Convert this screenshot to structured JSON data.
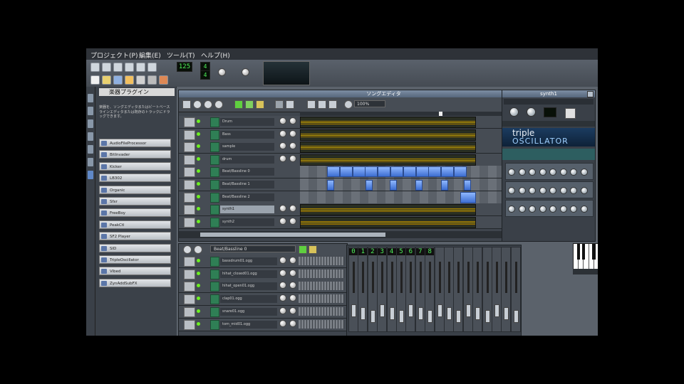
{
  "menu": [
    "プロジェクト(P)",
    "編集(E)",
    "ツール(T)",
    "ヘルプ(H)"
  ],
  "toolbar": {
    "tempo": "125",
    "time_sig_top": "4",
    "time_sig_bottom": "4"
  },
  "sidebar": {
    "title": "楽器プラグイン",
    "description": "楽器を、ソングエディタまたはビートベースラインエディタまたは既存のトラックにドラッグできます。",
    "plugins": [
      "AudioFileProcessor",
      "BitInvader",
      "Kicker",
      "LB302",
      "Organic",
      "Sfxr",
      "FreeBoy",
      "PeakCtl",
      "SF2 Player",
      "SID",
      "TripleOscillator",
      "Vibed",
      "ZynAddSubFX"
    ]
  },
  "song_editor": {
    "title": "ソングエディタ",
    "zoom": "100%",
    "tracks": [
      "Drum",
      "Bass",
      "sample",
      "drum",
      "Beat/Bassline 0",
      "Beat/Bassline 1",
      "Beat/Bassline 2",
      "synth1",
      "synth2"
    ]
  },
  "bb_editor": {
    "selector": "Beat/Bassline 0",
    "tracks": [
      "bassdrum01.ogg",
      "hihat_closed01.ogg",
      "hihat_open01.ogg",
      "clap01.ogg",
      "snare01.ogg",
      "tom_mid01.ogg"
    ]
  },
  "plugin_window": {
    "title": "synth1",
    "banner_line1": "triple",
    "banner_line2": "OSCILLATOR"
  },
  "mixer": {
    "channels": [
      "0",
      "1",
      "2",
      "3",
      "4",
      "5",
      "6",
      "7",
      "8"
    ]
  }
}
